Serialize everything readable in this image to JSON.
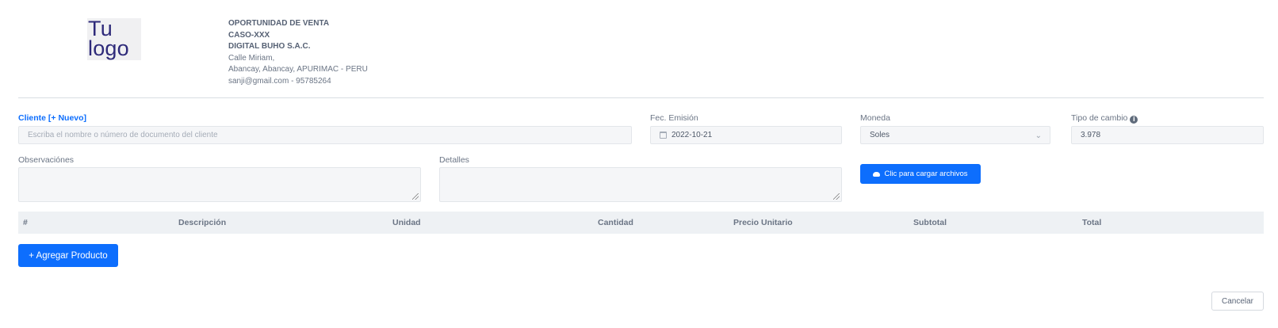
{
  "header": {
    "logo_line1": "Tu",
    "logo_line2": "logo",
    "doc_type": "OPORTUNIDAD DE VENTA",
    "case_code": "CASO-XXX",
    "company_name": "DIGITAL BUHO S.A.C.",
    "address": "Calle Miriam,",
    "location": "Abancay, Abancay, APURIMAC - PERU",
    "contact": "sanji@gmail.com - 95785264"
  },
  "form": {
    "client_label": "Cliente [+ Nuevo]",
    "client_placeholder": "Escriba el nombre o número de documento del cliente",
    "issue_date_label": "Fec. Emisión",
    "issue_date_value": "2022-10-21",
    "currency_label": "Moneda",
    "currency_value": "Soles",
    "exchange_rate_label": "Tipo de cambio",
    "exchange_rate_value": "3.978",
    "observations_label": "Observaciónes",
    "details_label": "Detalles",
    "upload_label": "Clic para cargar archivos"
  },
  "table": {
    "columns": [
      "#",
      "Descripción",
      "Unidad",
      "Cantidad",
      "Precio Unitario",
      "Subtotal",
      "Total"
    ]
  },
  "actions": {
    "add_product": "+ Agregar Producto",
    "cancel": "Cancelar"
  },
  "colors": {
    "primary": "#0d6efd",
    "logo_text": "#2e2a7a"
  }
}
